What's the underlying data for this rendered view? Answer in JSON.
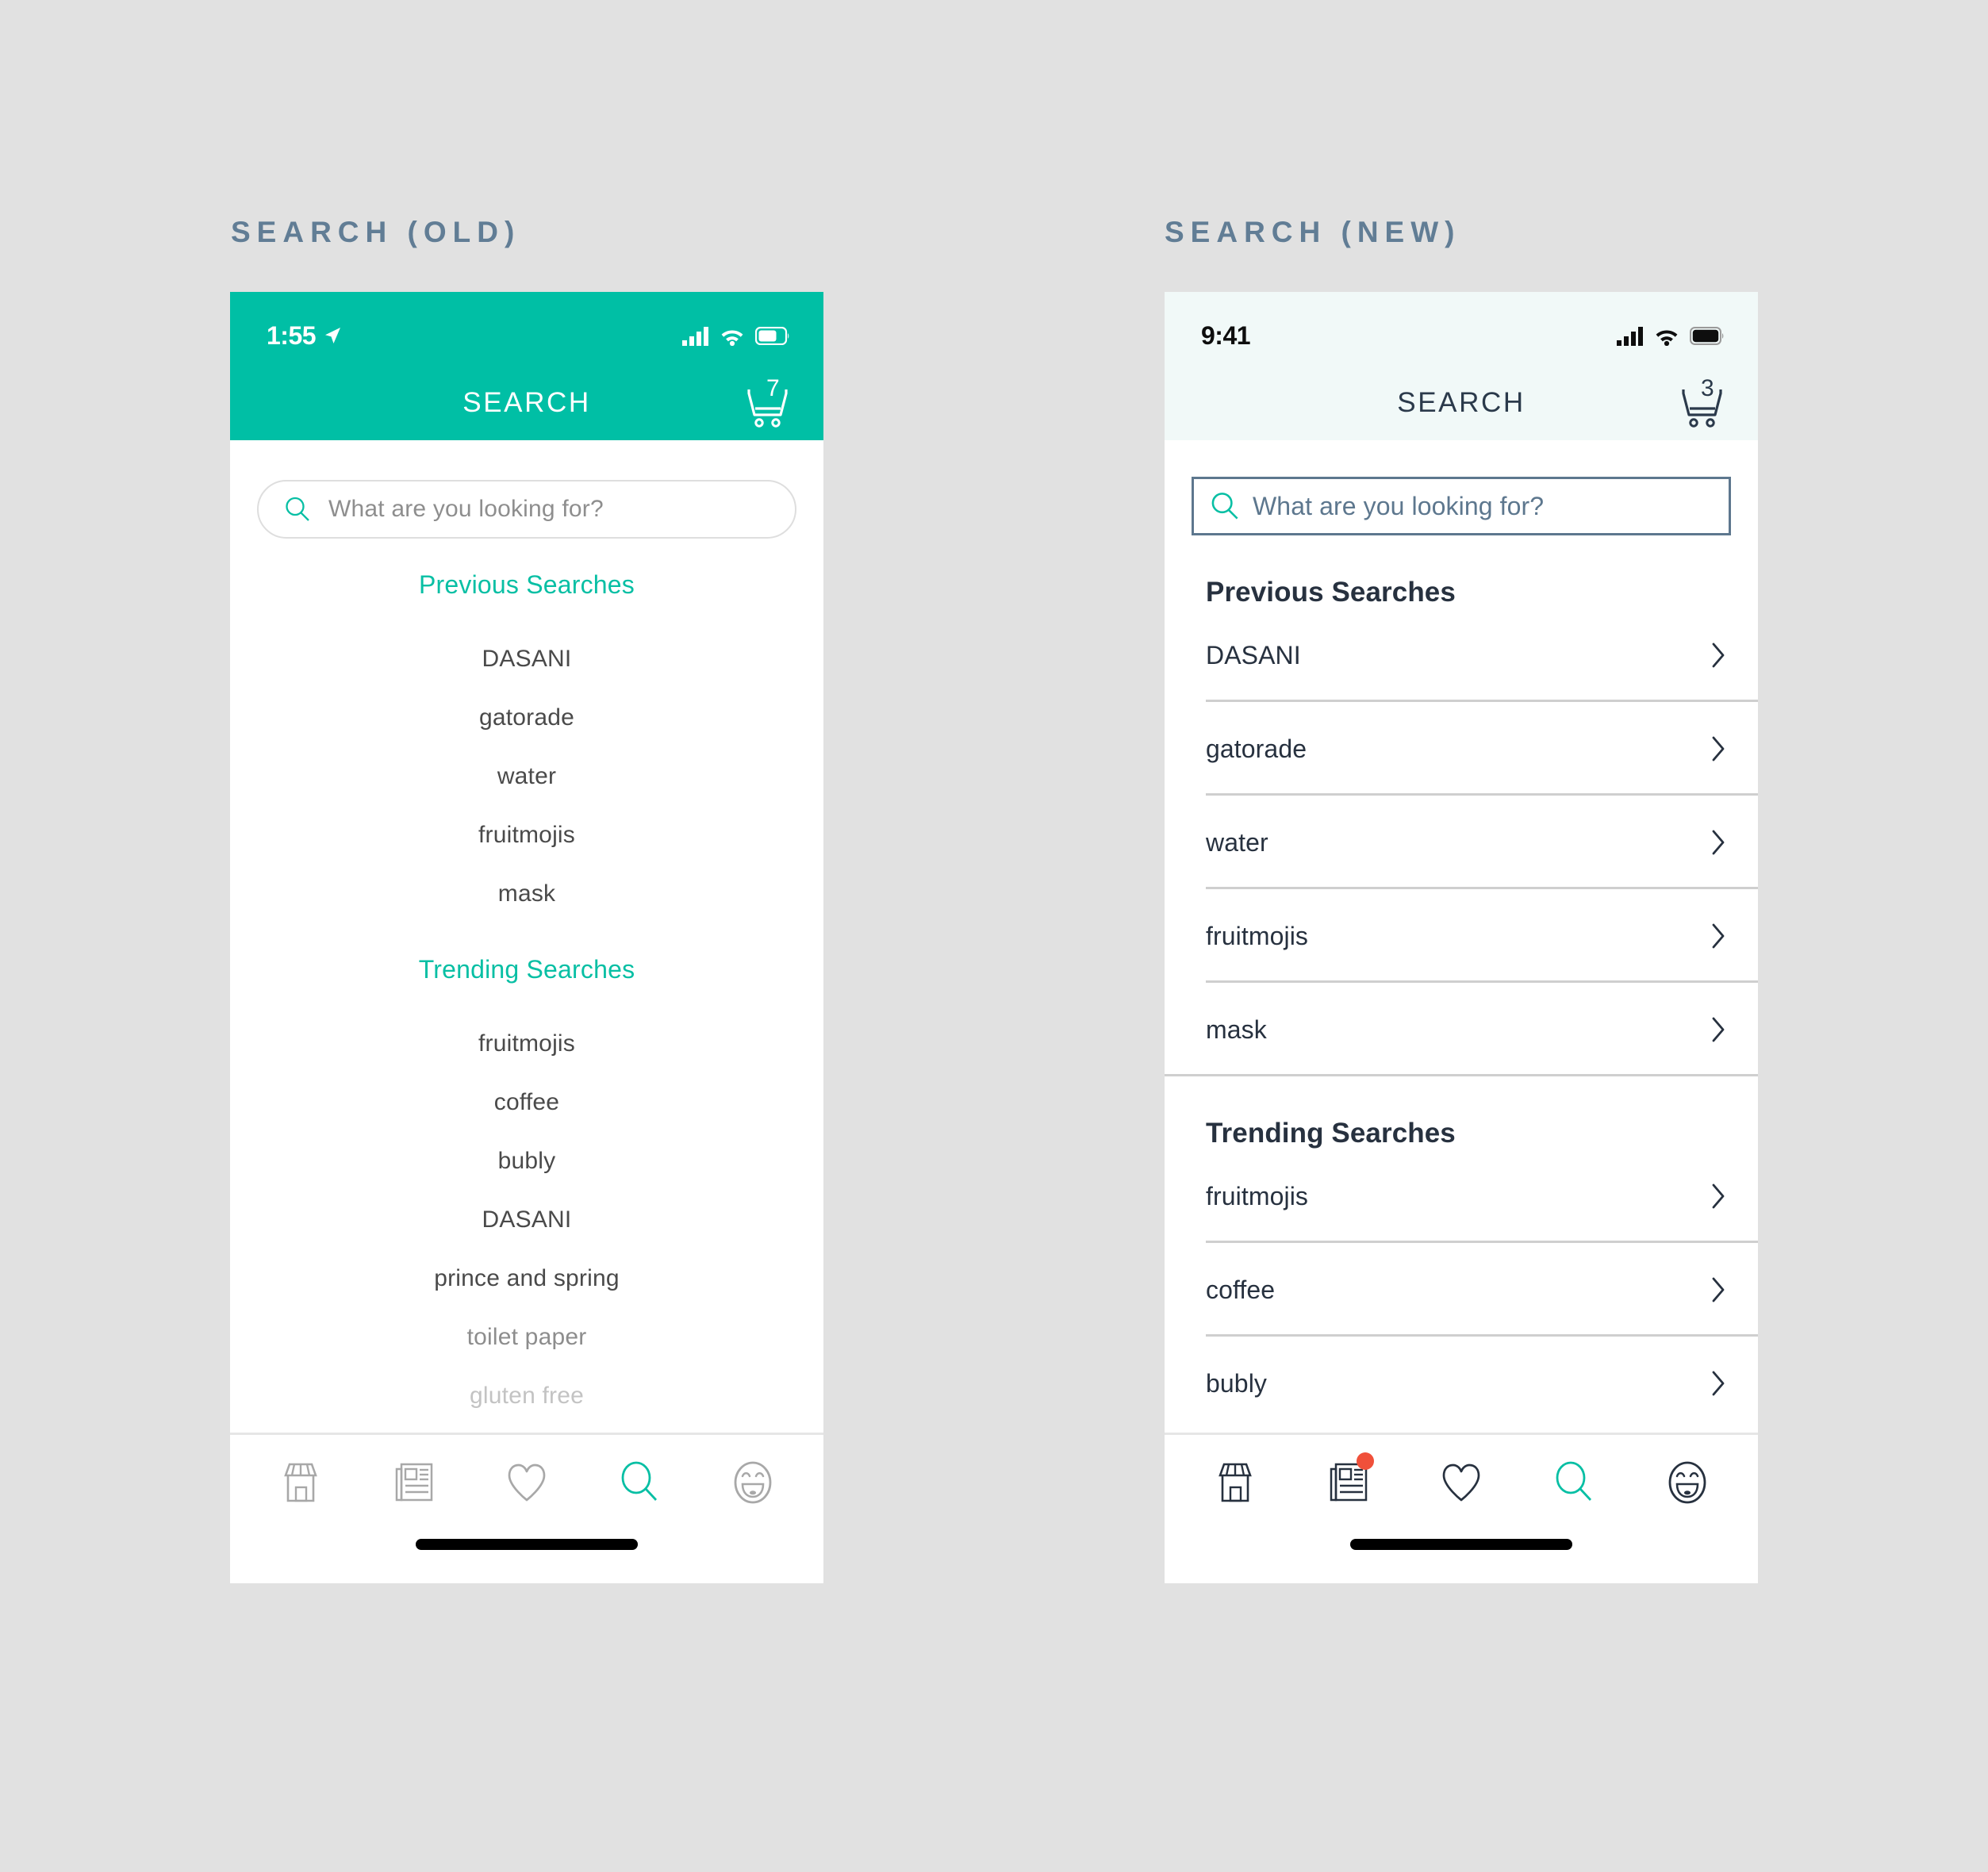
{
  "captions": {
    "old": "SEARCH (OLD)",
    "new": "SEARCH (NEW)"
  },
  "colors": {
    "canvas": "#e1e1e1",
    "teal": "#00bfa5",
    "teal_text": "#07bfa4",
    "navy": "#27313f",
    "slate": "#5d778e",
    "caption": "#617d95",
    "mint_header": "#f1f9f8",
    "badge_red": "#f0503a",
    "divider": "#cfcfcf",
    "old_item": "#4a4a4a"
  },
  "old_phone": {
    "status": {
      "time": "1:55",
      "location_icon": "location-arrow-icon",
      "signal_icon": "cellular-signal-icon",
      "wifi_icon": "wifi-icon",
      "battery_icon": "battery-icon"
    },
    "nav": {
      "title": "SEARCH",
      "cart_icon": "shopping-cart-icon",
      "cart_count": "7"
    },
    "search": {
      "placeholder": "What are you looking for?",
      "icon": "search-icon"
    },
    "sections": [
      {
        "heading": "Previous Searches",
        "items": [
          {
            "label": "DASANI",
            "fade": 0
          },
          {
            "label": "gatorade",
            "fade": 0
          },
          {
            "label": "water",
            "fade": 0
          },
          {
            "label": "fruitmojis",
            "fade": 0
          },
          {
            "label": "mask",
            "fade": 0
          }
        ]
      },
      {
        "heading": "Trending Searches",
        "items": [
          {
            "label": "fruitmojis",
            "fade": 0
          },
          {
            "label": "coffee",
            "fade": 0
          },
          {
            "label": "bubly",
            "fade": 0
          },
          {
            "label": "DASANI",
            "fade": 0
          },
          {
            "label": "prince and spring",
            "fade": 0
          },
          {
            "label": "toilet paper",
            "fade": 1
          },
          {
            "label": "gluten free",
            "fade": 2
          }
        ]
      }
    ],
    "tabs": [
      {
        "name": "storefront",
        "icon": "storefront-icon",
        "active": false,
        "badge": false
      },
      {
        "name": "news",
        "icon": "newspaper-icon",
        "active": false,
        "badge": false
      },
      {
        "name": "favorites",
        "icon": "heart-icon",
        "active": false,
        "badge": false
      },
      {
        "name": "search",
        "icon": "search-icon",
        "active": true,
        "badge": false
      },
      {
        "name": "account",
        "icon": "smiley-face-icon",
        "active": false,
        "badge": false
      }
    ]
  },
  "new_phone": {
    "status": {
      "time": "9:41",
      "signal_icon": "cellular-signal-icon",
      "wifi_icon": "wifi-icon",
      "battery_icon": "battery-icon"
    },
    "nav": {
      "title": "SEARCH",
      "cart_icon": "shopping-cart-icon",
      "cart_count": "3"
    },
    "search": {
      "placeholder": "What are you looking for?",
      "icon": "search-icon"
    },
    "sections": [
      {
        "heading": "Previous Searches",
        "items": [
          {
            "label": "DASANI"
          },
          {
            "label": "gatorade"
          },
          {
            "label": "water"
          },
          {
            "label": "fruitmojis"
          },
          {
            "label": "mask"
          }
        ]
      },
      {
        "heading": "Trending Searches",
        "items": [
          {
            "label": "fruitmojis"
          },
          {
            "label": "coffee"
          },
          {
            "label": "bubly"
          }
        ]
      }
    ],
    "row_chevron_icon": "chevron-right-icon",
    "tabs": [
      {
        "name": "storefront",
        "icon": "storefront-icon",
        "active": false,
        "badge": false
      },
      {
        "name": "news",
        "icon": "newspaper-icon",
        "active": false,
        "badge": true
      },
      {
        "name": "favorites",
        "icon": "heart-icon",
        "active": false,
        "badge": false
      },
      {
        "name": "search",
        "icon": "search-icon",
        "active": true,
        "badge": false
      },
      {
        "name": "account",
        "icon": "smiley-face-icon",
        "active": false,
        "badge": false
      }
    ]
  }
}
